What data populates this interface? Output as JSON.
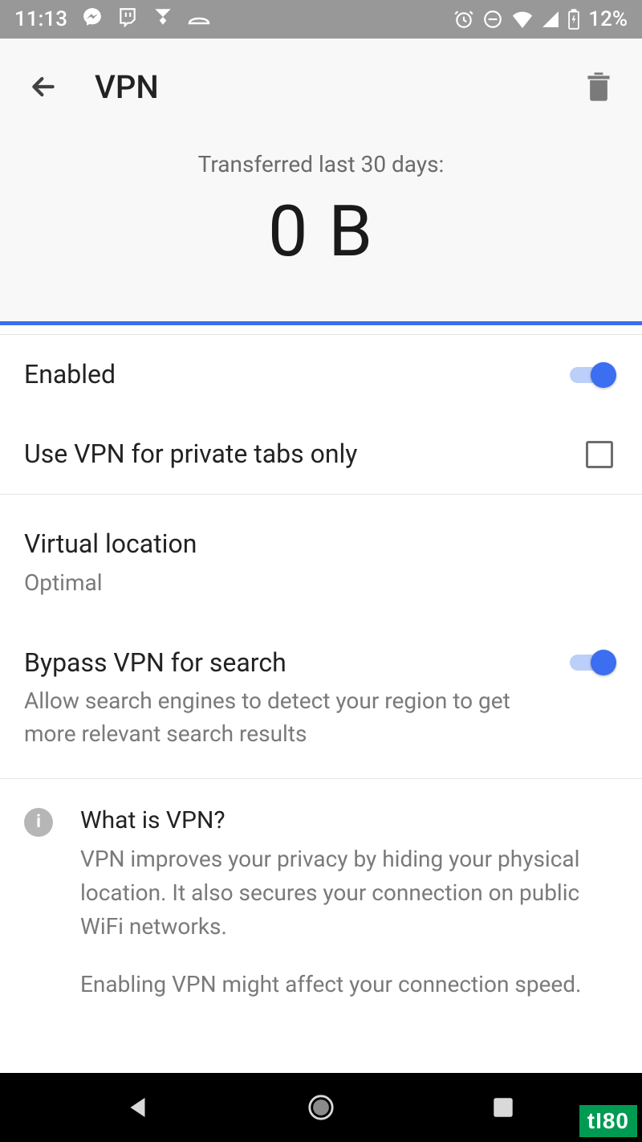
{
  "statusbar": {
    "time": "11:13",
    "battery": "12%"
  },
  "header": {
    "title": "VPN"
  },
  "hero": {
    "label": "Transferred last 30 days:",
    "value": "0 B"
  },
  "settings": {
    "enabled": {
      "title": "Enabled"
    },
    "privateTabsOnly": {
      "title": "Use VPN for private tabs only"
    },
    "virtualLocation": {
      "title": "Virtual location",
      "value": "Optimal"
    },
    "bypassSearch": {
      "title": "Bypass VPN for search",
      "desc": "Allow search engines to detect your region to get more relevant search results"
    }
  },
  "info": {
    "heading": "What is VPN?",
    "p1": "VPN improves your privacy by hiding your physical location. It also secures your connection on public WiFi networks.",
    "p2": "Enabling VPN might affect your connection speed."
  },
  "watermark": "tI80"
}
